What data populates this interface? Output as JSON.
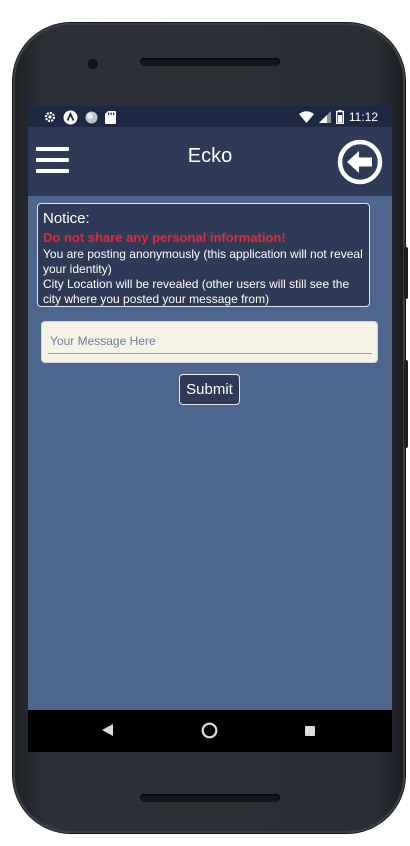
{
  "statusbar": {
    "time": "11:12",
    "left_icons": [
      "settings-icon",
      "a-circle-icon",
      "dot-icon",
      "sd-card-icon"
    ],
    "right_icons": [
      "wifi-icon",
      "signal-icon",
      "battery-icon"
    ]
  },
  "appbar": {
    "title": "Ecko",
    "menu_icon": "hamburger-menu-icon",
    "back_icon": "back-arrow-icon"
  },
  "notice": {
    "title": "Notice:",
    "warning": "Do not share any personal information!",
    "line1": "You are posting anonymously (this application will not reveal your identity)",
    "line2": "City Location will be revealed (other users will still see the city where you posted your message from)"
  },
  "message": {
    "placeholder": "Your Message Here",
    "value": ""
  },
  "submit_label": "Submit",
  "navbar": {
    "icons": [
      "nav-back-icon",
      "nav-home-icon",
      "nav-recents-icon"
    ]
  },
  "colors": {
    "background": "#4e658d",
    "appbar": "#2f3a57",
    "statusbar": "#1f2842",
    "warning": "#e0293a",
    "input_bg": "#f5f3e6"
  }
}
